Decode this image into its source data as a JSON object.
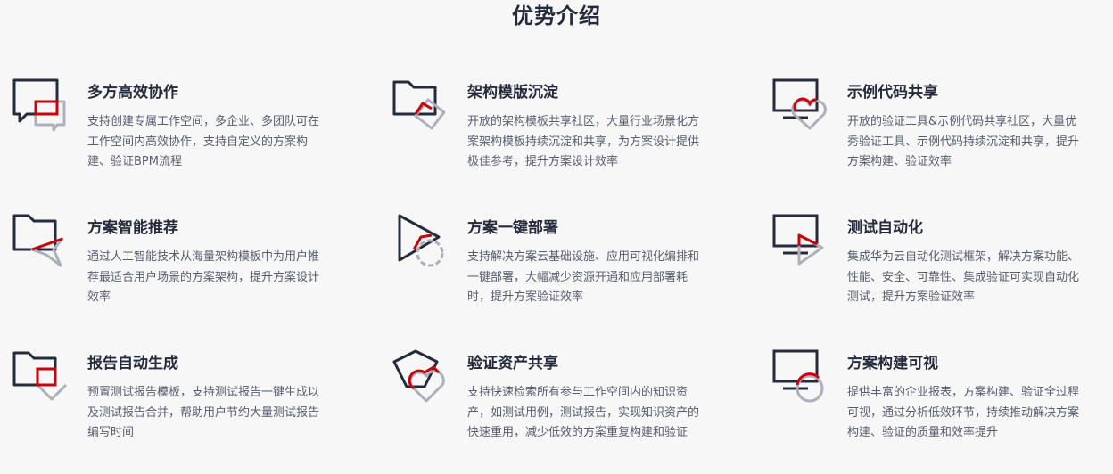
{
  "title": "优势介绍",
  "colors": {
    "dark": "#252b3a",
    "red": "#c7000b",
    "gray": "#adb0b8"
  },
  "features": [
    {
      "icon": "chat-bubbles-icon",
      "title": "多方高效协作",
      "desc": "支持创建专属工作空间，多企业、多团队可在\n工作空间内高效协作，支持自定义的方案构\n建、验证BPM流程"
    },
    {
      "icon": "folder-diamond-icon",
      "title": "架构模版沉淀",
      "desc": "开放的架构模板共享社区，大量行业场景化方\n案架构模板持续沉淀和共享，为方案设计提供\n极佳参考，提升方案设计效率"
    },
    {
      "icon": "monitor-heart-icon",
      "title": "示例代码共享",
      "desc": "开放的验证工具&示例代码共享社区，大量优\n秀验证工具、示例代码持续沉淀和共享，提升\n方案构建、验证效率"
    },
    {
      "icon": "folder-star-icon",
      "title": "方案智能推荐",
      "desc": "通过人工智能技术从海量架构模板中为用户推\n荐最适合用户场景的方案架构，提升方案设计\n效率"
    },
    {
      "icon": "play-gear-icon",
      "title": "方案一键部署",
      "desc": "支持解决方案云基础设施、应用可视化编排和\n一键部署，大幅减少资源开通和应用部署耗\n时，提升方案验证效率"
    },
    {
      "icon": "monitor-play-icon",
      "title": "测试自动化",
      "desc": "集成华为云自动化测试框架，解决方案功能、\n性能、安全、可靠性、集成验证可实现自动化\n测试，提升方案验证效率"
    },
    {
      "icon": "folder-check-icon",
      "title": "报告自动生成",
      "desc": "预置测试报告模板，支持测试报告一键生成以\n及测试报告合并，帮助用户节约大量测试报告\n编写时间"
    },
    {
      "icon": "pentagon-heart-icon",
      "title": "验证资产共享",
      "desc": "支持快速检索所有参与工作空间内的知识资\n产，如测试用例，测试报告，实现知识资产的\n快速重用，减少低效的方案重复构建和验证"
    },
    {
      "icon": "monitor-circle-icon",
      "title": "方案构建可视",
      "desc": "提供丰富的企业报表，方案构建、验证全过程\n可视，通过分析低效环节，持续推动解决方案\n构建、验证的质量和效率提升"
    }
  ]
}
